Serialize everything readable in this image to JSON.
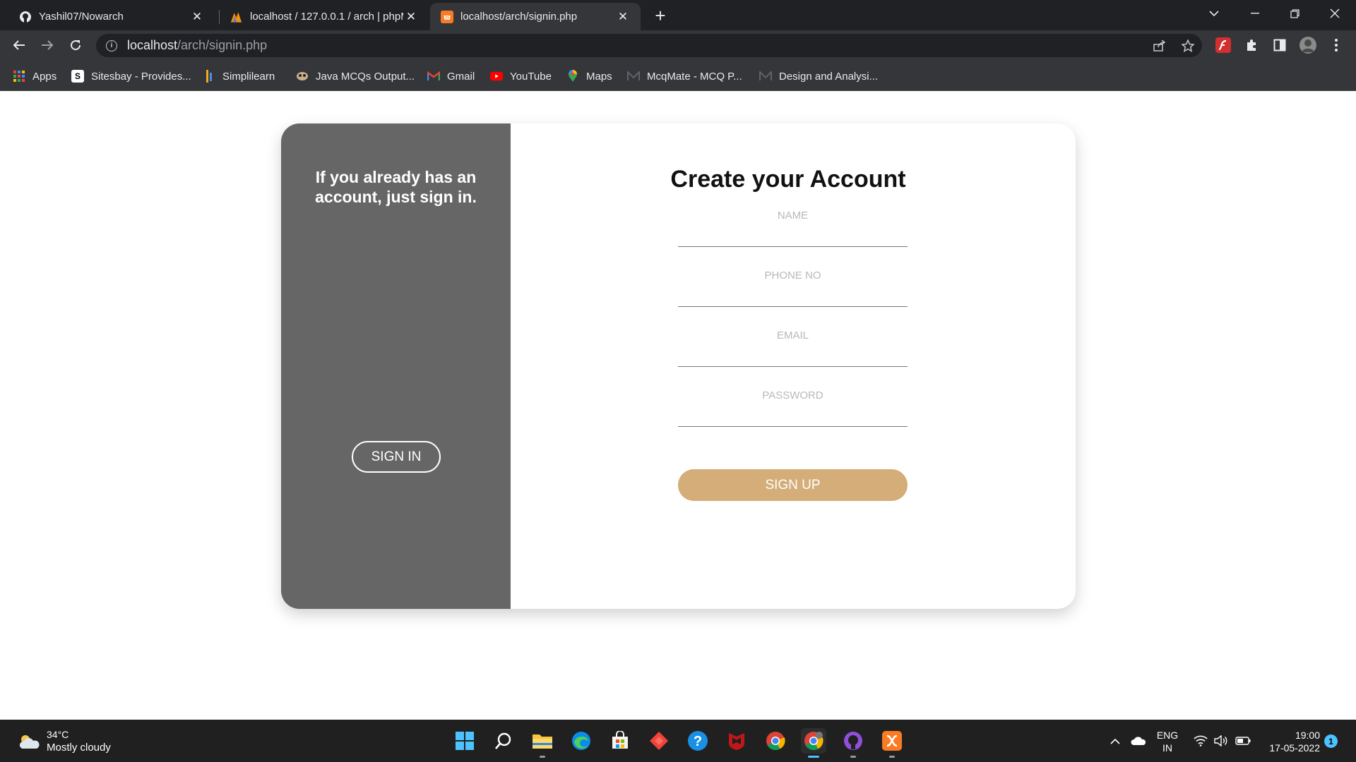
{
  "browser": {
    "tabs": [
      {
        "title": "Yashil07/Nowarch",
        "icon": "github-icon",
        "active": false
      },
      {
        "title": "localhost / 127.0.0.1 / arch | phpM",
        "icon": "phpmyadmin-icon",
        "active": false
      },
      {
        "title": "localhost/arch/signin.php",
        "icon": "xampp-icon",
        "active": true
      }
    ],
    "new_tab_label": "+",
    "address": {
      "host": "localhost",
      "path": "/arch/signin.php"
    },
    "bookmarks": [
      {
        "label": "Apps",
        "icon": "apps-grid-icon"
      },
      {
        "label": "Sitesbay - Provides...",
        "icon": "sitesbay-icon"
      },
      {
        "label": "Simplilearn",
        "icon": "simplilearn-icon"
      },
      {
        "label": "Java MCQs Output...",
        "icon": "java-mcq-icon"
      },
      {
        "label": "Gmail",
        "icon": "gmail-icon"
      },
      {
        "label": "YouTube",
        "icon": "youtube-icon"
      },
      {
        "label": "Maps",
        "icon": "maps-icon"
      },
      {
        "label": "McqMate - MCQ P...",
        "icon": "mcqmate-icon"
      },
      {
        "label": "Design and Analysi...",
        "icon": "mcqmate-icon"
      }
    ]
  },
  "page": {
    "left_panel": {
      "message": "If you already has an account, just sign in.",
      "signin_label": "SIGN IN",
      "color": "#666666"
    },
    "form": {
      "title": "Create your Account",
      "fields": [
        {
          "placeholder": "NAME",
          "value": ""
        },
        {
          "placeholder": "PHONE NO",
          "value": ""
        },
        {
          "placeholder": "EMAIL",
          "value": ""
        },
        {
          "placeholder": "PASSWORD",
          "value": ""
        }
      ],
      "signup_label": "SIGN UP",
      "accent": "#d4ad78"
    }
  },
  "taskbar": {
    "weather": {
      "temp": "34°C",
      "condition": "Mostly cloudy"
    },
    "apps": [
      "windows-start-icon",
      "search-icon",
      "file-explorer-icon",
      "edge-icon",
      "store-icon",
      "anydesk-icon",
      "help-icon",
      "mcafee-icon",
      "chrome-icon",
      "chrome-profile-icon",
      "github-desktop-icon",
      "xampp-icon"
    ],
    "lang": {
      "line1": "ENG",
      "line2": "IN"
    },
    "clock": {
      "time": "19:00",
      "date": "17-05-2022"
    },
    "notifications": "1"
  }
}
